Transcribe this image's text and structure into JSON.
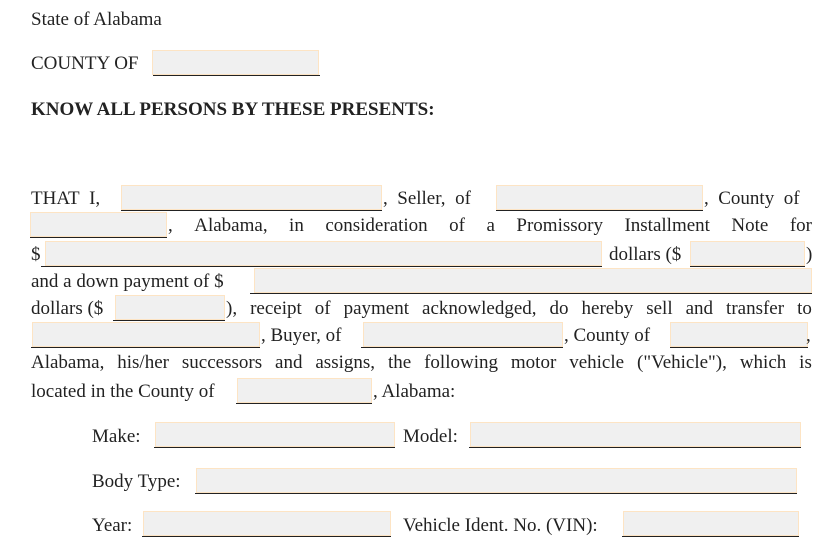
{
  "header": {
    "state_line": "State of Alabama",
    "county_label": "COUNTY OF",
    "heading": "KNOW ALL PERSONS BY THESE PRESENTS:"
  },
  "body": {
    "l1": [
      "THAT",
      "I,",
      ",",
      "Seller,",
      "of",
      ",",
      "County",
      "of"
    ],
    "l2": [
      ",",
      "Alabama,",
      "in",
      "consideration",
      "of",
      "a",
      "Promissory",
      "Installment",
      "Note",
      "for"
    ],
    "l3_dollar": "$",
    "l3_dollars": "dollars ($",
    "l3_close": ")",
    "l4": "and a down payment of $",
    "l5_a": "dollars ($",
    "l5_b": [
      "),",
      "receipt",
      "of",
      "payment",
      "acknowledged,",
      "do",
      "hereby",
      "sell",
      "and",
      "transfer",
      "to"
    ],
    "l6_buyer": ", Buyer, of",
    "l6_county": ", County of",
    "l6_comma": ",",
    "l7": [
      "Alabama,",
      "his/her",
      "successors",
      "and",
      "assigns,",
      "the",
      "following",
      "motor",
      "vehicle",
      "(\"Vehicle\"),",
      "which",
      "is"
    ],
    "l8_a": "located in the County of",
    "l8_b": ", Alabama:"
  },
  "vehicle": {
    "make_label": "Make:",
    "model_label": "Model:",
    "body_type_label": "Body Type:",
    "year_label": "Year:",
    "vin_label": "Vehicle Ident. No. (VIN):"
  },
  "fields": {
    "county": "",
    "seller_name": "",
    "seller_city": "",
    "seller_county": "",
    "note_amount_words": "",
    "note_amount": "",
    "down_payment_words": "",
    "down_payment_amount": "",
    "buyer_name": "",
    "buyer_city": "",
    "buyer_county": "",
    "vehicle_county": "",
    "make": "",
    "model": "",
    "body_type": "",
    "year": "",
    "vin": ""
  }
}
